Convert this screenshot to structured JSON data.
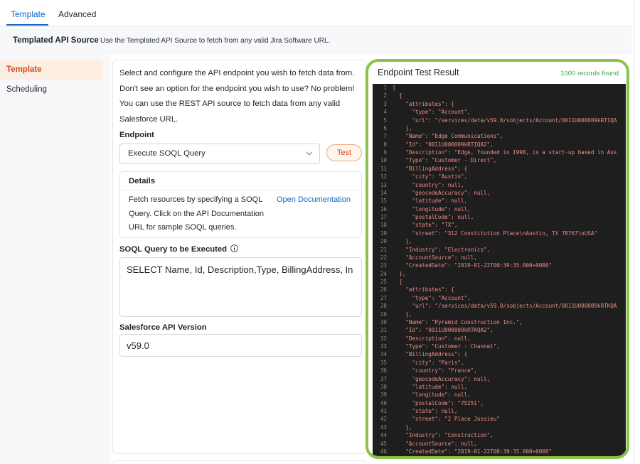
{
  "tabs": [
    {
      "label": "Template",
      "active": true
    },
    {
      "label": "Advanced",
      "active": false
    }
  ],
  "source": {
    "title": "Templated API Source",
    "description": "Use the Templated API Source to fetch from any valid Jira Software URL."
  },
  "sidebar": {
    "items": [
      {
        "label": "Template",
        "active": true
      },
      {
        "label": "Scheduling",
        "active": false
      }
    ]
  },
  "config": {
    "intro_lines": [
      "Select and configure the API endpoint you wish to fetch data from.",
      "Don't see an option for the endpoint you wish to use? No problem!",
      "You can use the REST API source to fetch data from any valid",
      "Salesforce URL."
    ],
    "endpoint_label": "Endpoint",
    "endpoint_value": "Execute SOQL Query",
    "test_label": "Test",
    "details_title": "Details",
    "details_lines": [
      "Fetch resources by specifying a SOQL",
      "Query. Click on the API Documentation",
      "URL for sample SOQL queries."
    ],
    "doc_link": "Open Documentation",
    "query_label": "SOQL Query to be Executed",
    "query_value": "SELECT Name, Id, Description,Type,  BillingAddress, In",
    "version_label": "Salesforce API Version",
    "version_value": "v59.0"
  },
  "result": {
    "title": "Endpoint Test Result",
    "count": "1000 records found",
    "accent": "#8bc34a",
    "lines": [
      {
        "n": "1",
        "t": "["
      },
      {
        "n": "2",
        "t": "  {"
      },
      {
        "n": "3",
        "t": "    \"attributes\": {"
      },
      {
        "n": "4",
        "t": "      \"type\": \"Account\","
      },
      {
        "n": "5",
        "t": "      \"url\": \"/services/data/v59.0/sobjects/Account/0011U000009kRTIQA"
      },
      {
        "n": "6",
        "t": "    },"
      },
      {
        "n": "7",
        "t": "    \"Name\": \"Edge Communications\","
      },
      {
        "n": "8",
        "t": "    \"Id\": \"0011U000009kRTIQA2\","
      },
      {
        "n": "9",
        "t": "    \"Description\": \"Edge, founded in 1998, is a start-up based in Aus"
      },
      {
        "n": "10",
        "t": "    \"Type\": \"Customer - Direct\","
      },
      {
        "n": "11",
        "t": "    \"BillingAddress\": {"
      },
      {
        "n": "12",
        "t": "      \"city\": \"Austin\","
      },
      {
        "n": "13",
        "t": "      \"country\": null,"
      },
      {
        "n": "14",
        "t": "      \"geocodeAccuracy\": null,"
      },
      {
        "n": "15",
        "t": "      \"latitude\": null,"
      },
      {
        "n": "16",
        "t": "      \"longitude\": null,"
      },
      {
        "n": "17",
        "t": "      \"postalCode\": null,"
      },
      {
        "n": "18",
        "t": "      \"state\": \"TX\","
      },
      {
        "n": "19",
        "t": "      \"street\": \"312 Constitution Place\\nAustin, TX 78767\\nUSA\""
      },
      {
        "n": "20",
        "t": "    },"
      },
      {
        "n": "21",
        "t": "    \"Industry\": \"Electronics\","
      },
      {
        "n": "22",
        "t": "    \"AccountSource\": null,"
      },
      {
        "n": "23",
        "t": "    \"CreatedDate\": \"2019-01-22T00:39:35.000+0000\""
      },
      {
        "n": "24",
        "t": "  },"
      },
      {
        "n": "25",
        "t": "  {"
      },
      {
        "n": "26",
        "t": "    \"attributes\": {"
      },
      {
        "n": "27",
        "t": "      \"type\": \"Account\","
      },
      {
        "n": "28",
        "t": "      \"url\": \"/services/data/v59.0/sobjects/Account/0011U000009kRTKQA"
      },
      {
        "n": "29",
        "t": "    },"
      },
      {
        "n": "30",
        "t": "    \"Name\": \"Pyramid Construction Inc.\","
      },
      {
        "n": "31",
        "t": "    \"Id\": \"0011U000009kRTKQA2\","
      },
      {
        "n": "32",
        "t": "    \"Description\": null,"
      },
      {
        "n": "33",
        "t": "    \"Type\": \"Customer - Channel\","
      },
      {
        "n": "34",
        "t": "    \"BillingAddress\": {"
      },
      {
        "n": "35",
        "t": "      \"city\": \"Paris\","
      },
      {
        "n": "36",
        "t": "      \"country\": \"France\","
      },
      {
        "n": "37",
        "t": "      \"geocodeAccuracy\": null,"
      },
      {
        "n": "38",
        "t": "      \"latitude\": null,"
      },
      {
        "n": "39",
        "t": "      \"longitude\": null,"
      },
      {
        "n": "40",
        "t": "      \"postalCode\": \"75251\","
      },
      {
        "n": "41",
        "t": "      \"state\": null,"
      },
      {
        "n": "42",
        "t": "      \"street\": \"2 Place Jussieu\""
      },
      {
        "n": "43",
        "t": "    },"
      },
      {
        "n": "44",
        "t": "    \"Industry\": \"Construction\","
      },
      {
        "n": "45",
        "t": "    \"AccountSource\": null,"
      },
      {
        "n": "46",
        "t": "    \"CreatedDate\": \"2019-01-22T00:39:35.000+0000\""
      }
    ]
  }
}
